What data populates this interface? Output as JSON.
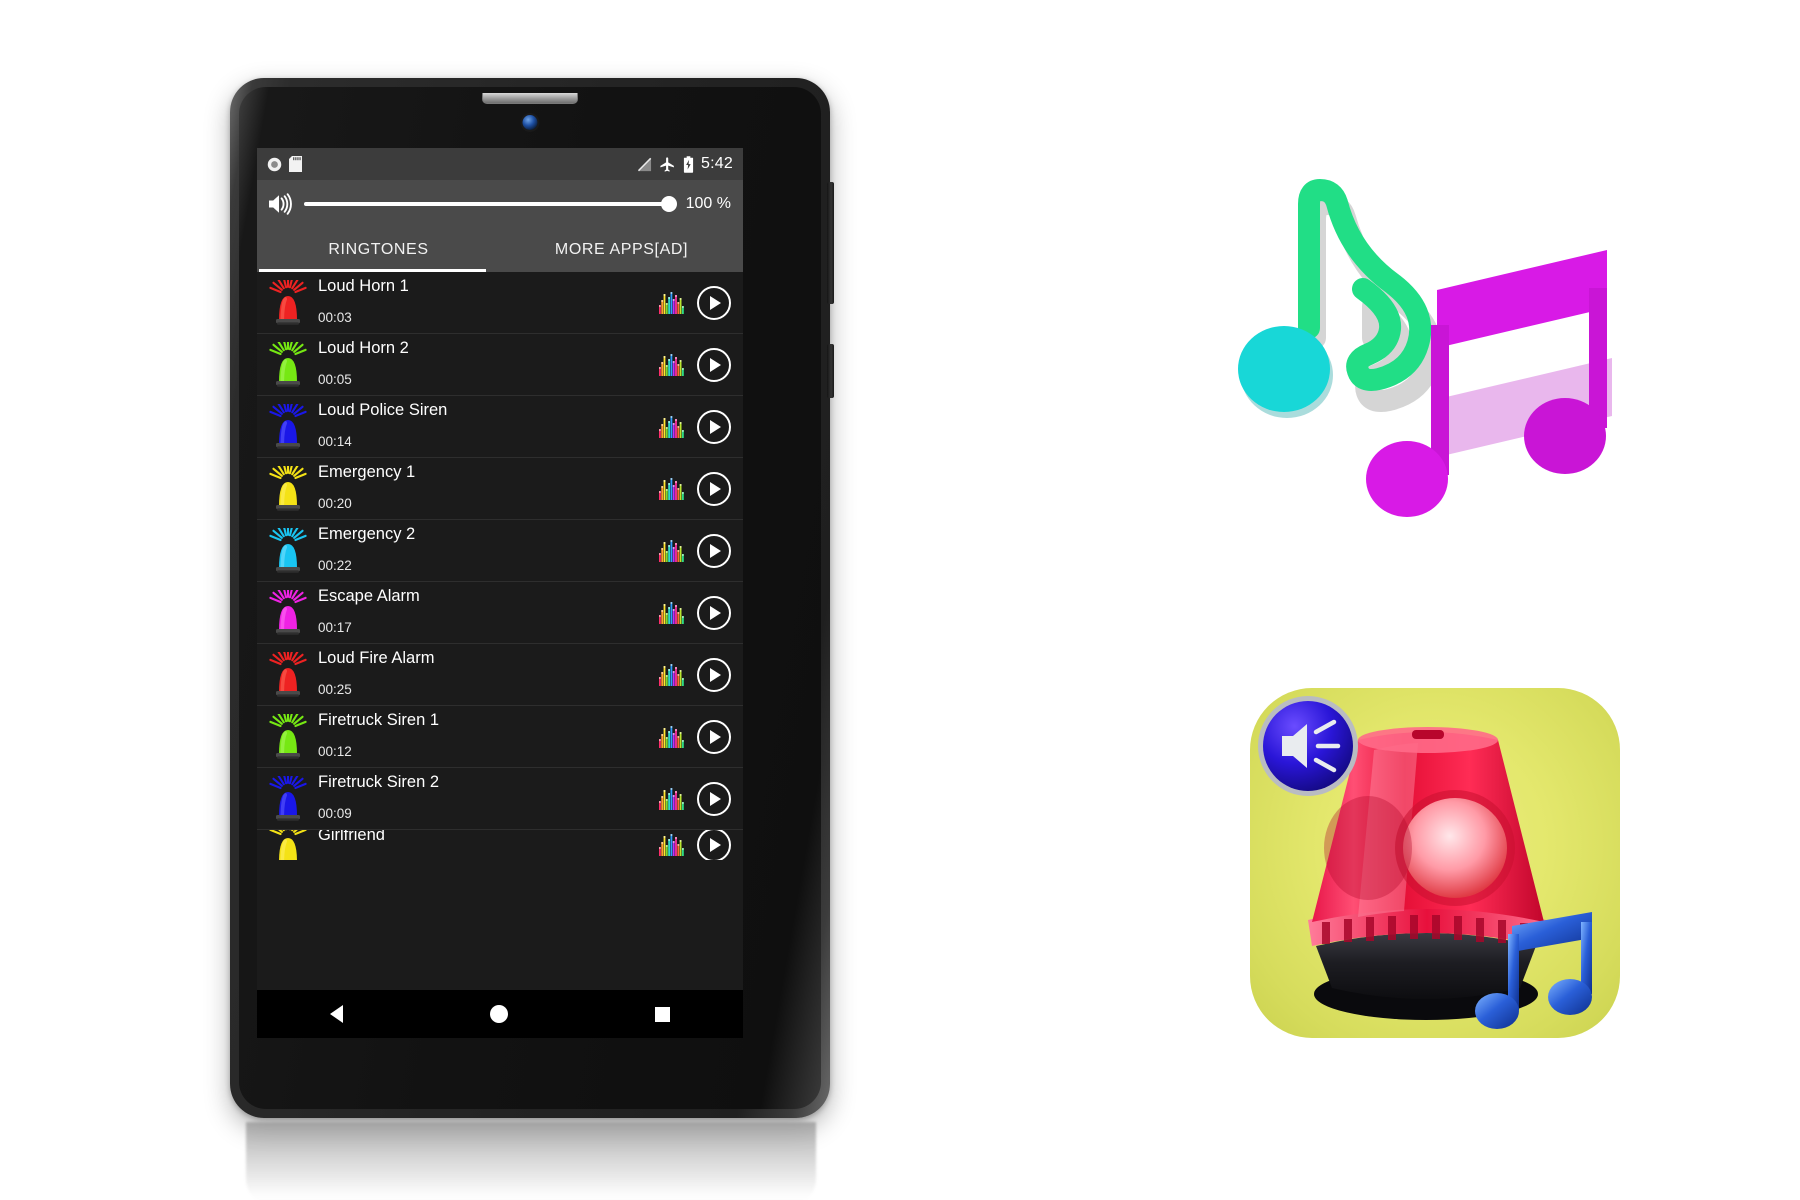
{
  "device": {
    "name": "android-tablet",
    "speaker_grille": "speaker-grille",
    "camera": "front-camera",
    "side_buttons": [
      "volume-rocker",
      "power-button"
    ]
  },
  "statusbar": {
    "left_icons": [
      "record-indicator-icon",
      "sd-card-icon"
    ],
    "right_icons": [
      "no-signal-icon",
      "airplane-mode-icon",
      "battery-charging-icon"
    ],
    "time": "5:42"
  },
  "volume": {
    "icon": "speaker-volume-icon",
    "value": 100,
    "percent_label": "100 %"
  },
  "tabs": [
    {
      "label": "RINGTONES",
      "active": true
    },
    {
      "label": "MORE APPS[AD]",
      "active": false
    }
  ],
  "ringtones": [
    {
      "title": "Loud Horn 1",
      "duration": "00:03",
      "color": "#ee2222",
      "light": "#ff6a5a"
    },
    {
      "title": "Loud Horn 2",
      "duration": "00:05",
      "color": "#76e813",
      "light": "#a9f763"
    },
    {
      "title": "Loud Police Siren",
      "duration": "00:14",
      "color": "#1a17e8",
      "light": "#6360ff"
    },
    {
      "title": "Emergency 1",
      "duration": "00:20",
      "color": "#f4e216",
      "light": "#fff06a"
    },
    {
      "title": "Emergency 2",
      "duration": "00:22",
      "color": "#19c5f2",
      "light": "#7fe2ff"
    },
    {
      "title": "Escape Alarm",
      "duration": "00:17",
      "color": "#ef22e4",
      "light": "#ff77f4"
    },
    {
      "title": "Loud Fire Alarm",
      "duration": "00:25",
      "color": "#ee2222",
      "light": "#ff6a5a"
    },
    {
      "title": "Firetruck Siren 1",
      "duration": "00:12",
      "color": "#76e813",
      "light": "#a9f763"
    },
    {
      "title": "Firetruck Siren 2",
      "duration": "00:09",
      "color": "#1a17e8",
      "light": "#6360ff"
    },
    {
      "title": "Girlfriend",
      "duration": "",
      "color": "#f4e216",
      "light": "#fff06a",
      "clipped": true
    }
  ],
  "row_controls": {
    "equalizer_icon": "equalizer-icon",
    "play_icon": "play-button-icon"
  },
  "navbar": {
    "back": "back-button",
    "home": "home-button",
    "recents": "recents-button"
  },
  "artwork": {
    "music_notes": {
      "name": "music-notes-illustration",
      "note1_stem_color": "#21de86",
      "note1_head_color": "#18d7d7",
      "note2_color": "#c915d6",
      "note2_beam_color": "#d81ae6"
    },
    "app_icon": {
      "name": "app-icon-siren-ringtones",
      "background_color": "#e3e76c",
      "siren_color": "#ef1d3e",
      "base_color": "#1d1d22",
      "badge_color": "#2a16d8",
      "notes_color": "#2a5fd8"
    }
  }
}
